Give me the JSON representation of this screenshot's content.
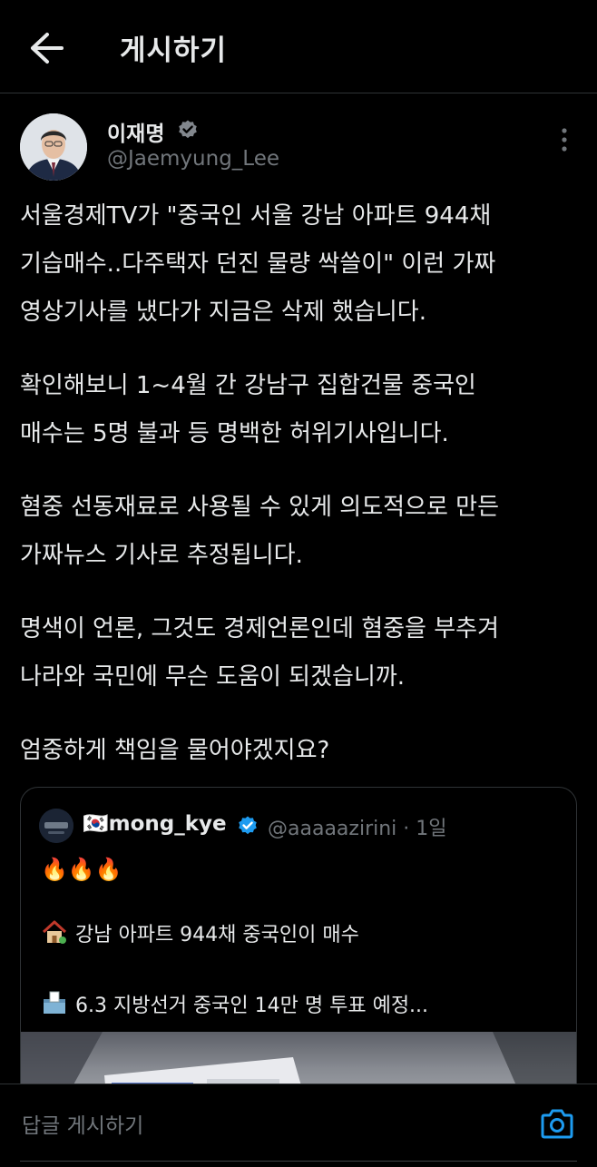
{
  "header": {
    "title": "게시하기",
    "back_icon": "arrow-left-icon"
  },
  "author": {
    "display_name": "이재명",
    "handle": "@Jaemyung_Lee",
    "verified": true
  },
  "post": {
    "paragraphs": [
      "서울경제TV가 \"중국인 서울 강남 아파트 944채\n기습매수..다주택자 던진 물량 싹쓸이\" 이런 가짜\n영상기사를 냈다가 지금은 삭제 했습니다.",
      "확인해보니 1~4월 간 강남구 집합건물 중국인\n매수는 5명 불과 등 명백한 허위기사입니다.",
      "혐중 선동재료로 사용될 수 있게 의도적으로 만든\n가짜뉴스 기사로 추정됩니다.",
      "명색이 언론, 그것도 경제언론인데 혐중을 부추겨\n나라와 국민에 무슨 도움이 되겠습니까.",
      "엄중하게 책임을 물어야겠지요?"
    ]
  },
  "quoted": {
    "display_name": "🇰🇷mong_kye",
    "handle_time": "@aaaaazirini · 1일",
    "emoji_line": "🔥🔥🔥",
    "line1": "강남 아파트 944채 중국인이 매수",
    "line2": "6.3 지방선거 중국인 14만 명 투표 예정...",
    "line1_icon": "house-icon",
    "line2_icon": "ballot-box-icon"
  },
  "reply": {
    "placeholder": "답글 게시하기",
    "camera_icon": "camera-icon"
  },
  "colors": {
    "background": "#000000",
    "text": "#e7e9ea",
    "secondary": "#71767b",
    "accent": "#1d9bf0",
    "border": "#2f3336"
  }
}
